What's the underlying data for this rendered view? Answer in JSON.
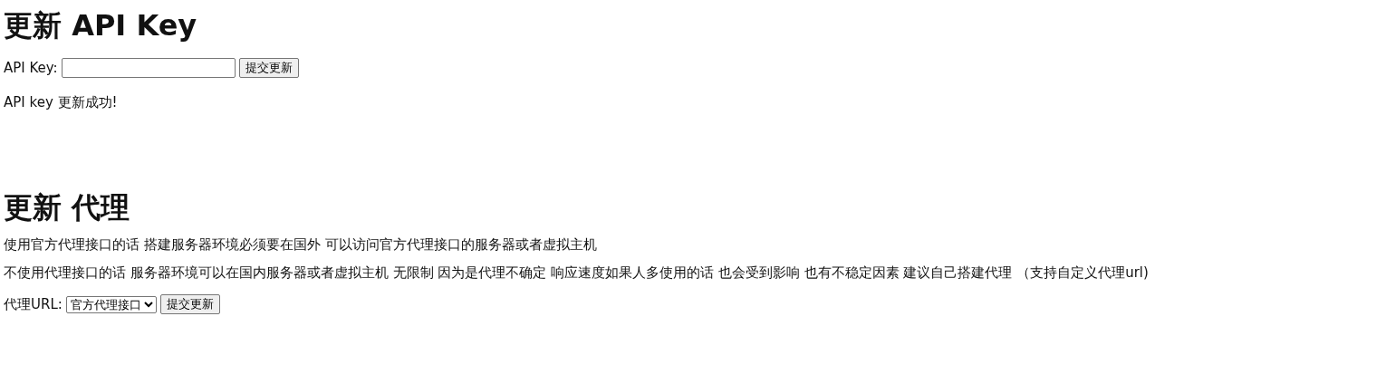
{
  "api_key_section": {
    "heading": "更新 API Key",
    "field_label": "API Key:",
    "submit_button": "提交更新",
    "message": "API key 更新成功!"
  },
  "proxy_section": {
    "heading": "更新 代理",
    "paragraphs": [
      "使用官方代理接口的话 搭建服务器环境必须要在国外 可以访问官方代理接口的服务器或者虚拟主机",
      "不使用代理接口的话 服务器环境可以在国内服务器或者虚拟主机 无限制 因为是代理不确定 响应速度如果人多使用的话 也会受到影响 也有不稳定因素 建议自己搭建代理 （支持自定义代理url)"
    ],
    "field_label": "代理URL:",
    "select": {
      "value": "官方代理接口"
    },
    "submit_button": "提交更新"
  }
}
